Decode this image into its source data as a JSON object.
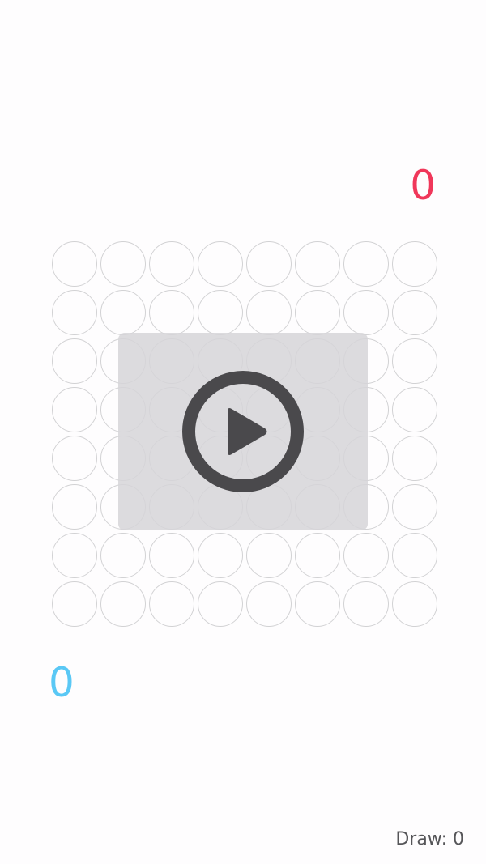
{
  "scores": {
    "red": "0",
    "blue": "0"
  },
  "draw": {
    "label": "Draw:",
    "value": "0"
  },
  "colors": {
    "red": "#f0375a",
    "blue": "#5ac8f5",
    "cell_border": "#d2d2d4",
    "overlay": "#d6d5d8",
    "play_icon": "#4a494c"
  },
  "board": {
    "rows": 8,
    "columns": 8
  },
  "overlay": {
    "icon": "play-icon"
  }
}
